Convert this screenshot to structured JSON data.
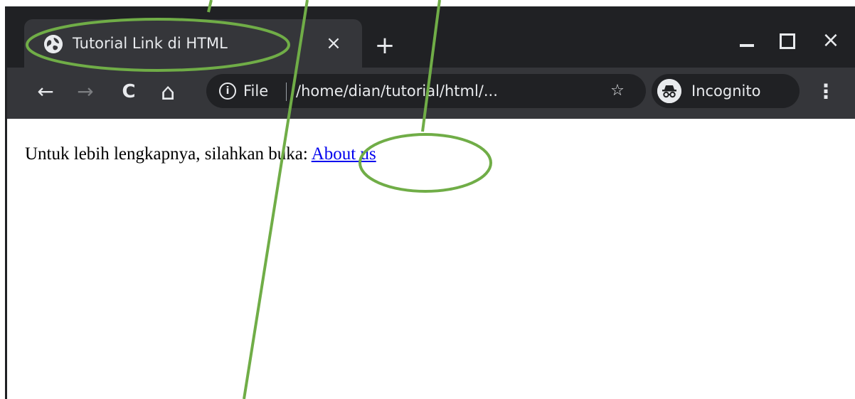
{
  "tab": {
    "title": "Tutorial Link di HTML",
    "close_label": "×"
  },
  "tabstrip": {
    "new_tab_label": "+",
    "close_window_label": "×"
  },
  "toolbar": {
    "back_icon": "arrow-left-icon",
    "forward_icon": "arrow-right-icon",
    "reload_icon": "reload-icon",
    "home_icon": "home-icon",
    "back_label": "←",
    "forward_label": "→",
    "reload_label": "C",
    "home_label": "⌂",
    "menu_label": "⋮"
  },
  "omnibox": {
    "info_label": "i",
    "scheme_label": "File",
    "url": "/home/dian/tutorial/html/...",
    "star_label": "☆"
  },
  "incognito": {
    "label": "Incognito"
  },
  "page": {
    "text": "Untuk lebih lengkapnya, silahkan buka: ",
    "link_text": "About us"
  },
  "colors": {
    "tabstrip": "#202124",
    "toolbar": "#35363a",
    "link": "#0000ee",
    "annotation": "#70ad47"
  }
}
